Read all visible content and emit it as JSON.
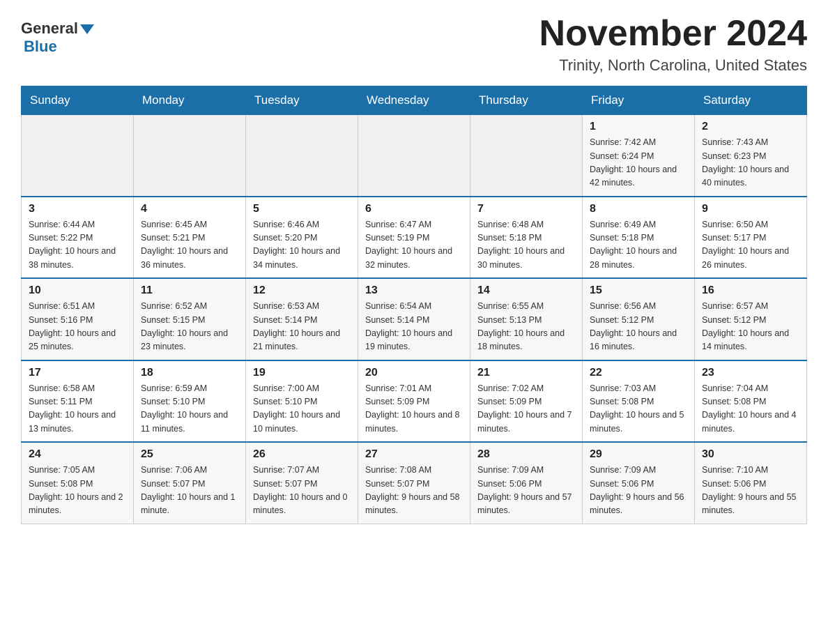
{
  "header": {
    "logo": {
      "general": "General",
      "blue": "Blue"
    },
    "title": "November 2024",
    "location": "Trinity, North Carolina, United States"
  },
  "days_of_week": [
    "Sunday",
    "Monday",
    "Tuesday",
    "Wednesday",
    "Thursday",
    "Friday",
    "Saturday"
  ],
  "weeks": [
    [
      {
        "day": "",
        "info": ""
      },
      {
        "day": "",
        "info": ""
      },
      {
        "day": "",
        "info": ""
      },
      {
        "day": "",
        "info": ""
      },
      {
        "day": "",
        "info": ""
      },
      {
        "day": "1",
        "info": "Sunrise: 7:42 AM\nSunset: 6:24 PM\nDaylight: 10 hours and 42 minutes."
      },
      {
        "day": "2",
        "info": "Sunrise: 7:43 AM\nSunset: 6:23 PM\nDaylight: 10 hours and 40 minutes."
      }
    ],
    [
      {
        "day": "3",
        "info": "Sunrise: 6:44 AM\nSunset: 5:22 PM\nDaylight: 10 hours and 38 minutes."
      },
      {
        "day": "4",
        "info": "Sunrise: 6:45 AM\nSunset: 5:21 PM\nDaylight: 10 hours and 36 minutes."
      },
      {
        "day": "5",
        "info": "Sunrise: 6:46 AM\nSunset: 5:20 PM\nDaylight: 10 hours and 34 minutes."
      },
      {
        "day": "6",
        "info": "Sunrise: 6:47 AM\nSunset: 5:19 PM\nDaylight: 10 hours and 32 minutes."
      },
      {
        "day": "7",
        "info": "Sunrise: 6:48 AM\nSunset: 5:18 PM\nDaylight: 10 hours and 30 minutes."
      },
      {
        "day": "8",
        "info": "Sunrise: 6:49 AM\nSunset: 5:18 PM\nDaylight: 10 hours and 28 minutes."
      },
      {
        "day": "9",
        "info": "Sunrise: 6:50 AM\nSunset: 5:17 PM\nDaylight: 10 hours and 26 minutes."
      }
    ],
    [
      {
        "day": "10",
        "info": "Sunrise: 6:51 AM\nSunset: 5:16 PM\nDaylight: 10 hours and 25 minutes."
      },
      {
        "day": "11",
        "info": "Sunrise: 6:52 AM\nSunset: 5:15 PM\nDaylight: 10 hours and 23 minutes."
      },
      {
        "day": "12",
        "info": "Sunrise: 6:53 AM\nSunset: 5:14 PM\nDaylight: 10 hours and 21 minutes."
      },
      {
        "day": "13",
        "info": "Sunrise: 6:54 AM\nSunset: 5:14 PM\nDaylight: 10 hours and 19 minutes."
      },
      {
        "day": "14",
        "info": "Sunrise: 6:55 AM\nSunset: 5:13 PM\nDaylight: 10 hours and 18 minutes."
      },
      {
        "day": "15",
        "info": "Sunrise: 6:56 AM\nSunset: 5:12 PM\nDaylight: 10 hours and 16 minutes."
      },
      {
        "day": "16",
        "info": "Sunrise: 6:57 AM\nSunset: 5:12 PM\nDaylight: 10 hours and 14 minutes."
      }
    ],
    [
      {
        "day": "17",
        "info": "Sunrise: 6:58 AM\nSunset: 5:11 PM\nDaylight: 10 hours and 13 minutes."
      },
      {
        "day": "18",
        "info": "Sunrise: 6:59 AM\nSunset: 5:10 PM\nDaylight: 10 hours and 11 minutes."
      },
      {
        "day": "19",
        "info": "Sunrise: 7:00 AM\nSunset: 5:10 PM\nDaylight: 10 hours and 10 minutes."
      },
      {
        "day": "20",
        "info": "Sunrise: 7:01 AM\nSunset: 5:09 PM\nDaylight: 10 hours and 8 minutes."
      },
      {
        "day": "21",
        "info": "Sunrise: 7:02 AM\nSunset: 5:09 PM\nDaylight: 10 hours and 7 minutes."
      },
      {
        "day": "22",
        "info": "Sunrise: 7:03 AM\nSunset: 5:08 PM\nDaylight: 10 hours and 5 minutes."
      },
      {
        "day": "23",
        "info": "Sunrise: 7:04 AM\nSunset: 5:08 PM\nDaylight: 10 hours and 4 minutes."
      }
    ],
    [
      {
        "day": "24",
        "info": "Sunrise: 7:05 AM\nSunset: 5:08 PM\nDaylight: 10 hours and 2 minutes."
      },
      {
        "day": "25",
        "info": "Sunrise: 7:06 AM\nSunset: 5:07 PM\nDaylight: 10 hours and 1 minute."
      },
      {
        "day": "26",
        "info": "Sunrise: 7:07 AM\nSunset: 5:07 PM\nDaylight: 10 hours and 0 minutes."
      },
      {
        "day": "27",
        "info": "Sunrise: 7:08 AM\nSunset: 5:07 PM\nDaylight: 9 hours and 58 minutes."
      },
      {
        "day": "28",
        "info": "Sunrise: 7:09 AM\nSunset: 5:06 PM\nDaylight: 9 hours and 57 minutes."
      },
      {
        "day": "29",
        "info": "Sunrise: 7:09 AM\nSunset: 5:06 PM\nDaylight: 9 hours and 56 minutes."
      },
      {
        "day": "30",
        "info": "Sunrise: 7:10 AM\nSunset: 5:06 PM\nDaylight: 9 hours and 55 minutes."
      }
    ]
  ]
}
